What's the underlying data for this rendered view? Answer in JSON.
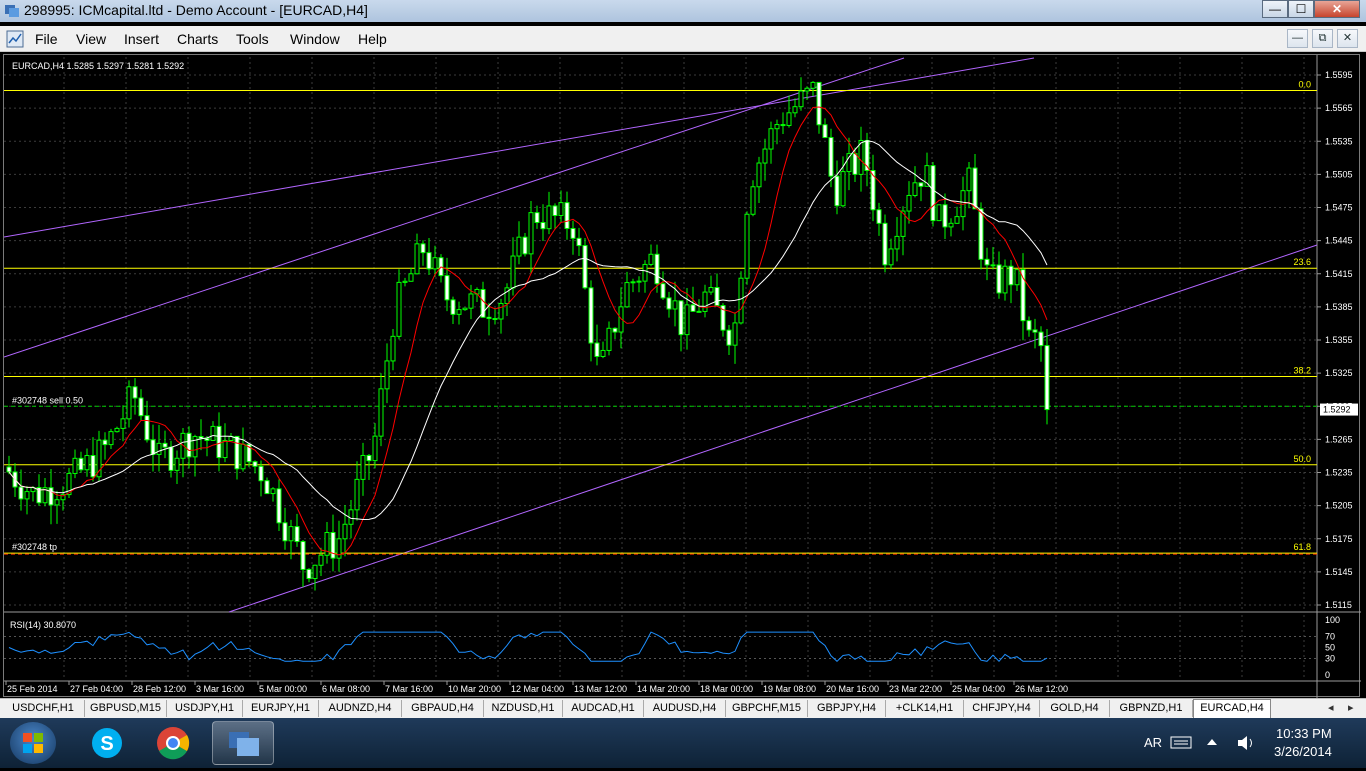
{
  "window": {
    "title": "298995: ICMcapital.ltd - Demo Account - [EURCAD,H4]",
    "buttons": {
      "minimize": "—",
      "maximize": "☐",
      "close": "✕"
    }
  },
  "menu": {
    "items": [
      "File",
      "View",
      "Insert",
      "Charts",
      "Tools",
      "Window",
      "Help"
    ],
    "mdi_buttons": {
      "minimize": "—",
      "restore": "⧉",
      "close": "✕"
    }
  },
  "chart": {
    "header": "EURCAD,H4  1.5285 1.5297 1.5281 1.5292",
    "current_price": "1.5292",
    "price_scale": [
      "1.5595",
      "1.5565",
      "1.5535",
      "1.5505",
      "1.5475",
      "1.5445",
      "1.5415",
      "1.5385",
      "1.5355",
      "1.5325",
      "1.5295",
      "1.5265",
      "1.5235",
      "1.5205",
      "1.5175",
      "1.5145",
      "1.5115"
    ],
    "fib_levels": [
      {
        "label": "0.0",
        "price": 1.5581
      },
      {
        "label": "23.6",
        "price": 1.542
      },
      {
        "label": "38.2",
        "price": 1.5322
      },
      {
        "label": "50.0",
        "price": 1.5242
      },
      {
        "label": "61.8",
        "price": 1.5162
      }
    ],
    "order_labels": {
      "sell": "#302748 sell 0.50",
      "tp": "#302748 tp"
    },
    "sell_price": 1.5295,
    "tp_price": 1.5162,
    "time_axis": [
      "25 Feb 2014",
      "27 Feb 04:00",
      "28 Feb 12:00",
      "3 Mar 16:00",
      "5 Mar 00:00",
      "6 Mar 08:00",
      "7 Mar 16:00",
      "10 Mar 20:00",
      "12 Mar 04:00",
      "13 Mar 12:00",
      "14 Mar 20:00",
      "18 Mar 00:00",
      "19 Mar 08:00",
      "20 Mar 16:00",
      "23 Mar 22:00",
      "25 Mar 04:00",
      "26 Mar 12:00"
    ],
    "colors": {
      "bull": "#00ff00",
      "bear": "#ffffff",
      "grid": "#3c3c3c",
      "fib": "#ffff00",
      "channel": "#b266ff",
      "ma_fast": "#ff0000",
      "ma_slow": "#ffffff",
      "tp_line": "#ff3300",
      "rsi": "#1e90ff"
    }
  },
  "rsi": {
    "label": "RSI(14) 30.8070",
    "scale": [
      "100",
      "70",
      "50",
      "30",
      "0"
    ]
  },
  "tabs": {
    "items": [
      "USDCHF,H1",
      "GBPUSD,M15",
      "USDJPY,H1",
      "EURJPY,H1",
      "AUDNZD,H4",
      "GBPAUD,H4",
      "NZDUSD,H1",
      "AUDCAD,H1",
      "AUDUSD,H4",
      "GBPCHF,M15",
      "GBPJPY,H4",
      "+CLK14,H1",
      "CHFJPY,H4",
      "GOLD,H4",
      "GBPNZD,H1",
      "EURCAD,H4"
    ],
    "active": "EURCAD,H4"
  },
  "taskbar": {
    "language": "AR",
    "time": "10:33 PM",
    "date": "3/26/2014",
    "apps": [
      "windows-start",
      "skype",
      "chrome",
      "metatrader"
    ]
  }
}
